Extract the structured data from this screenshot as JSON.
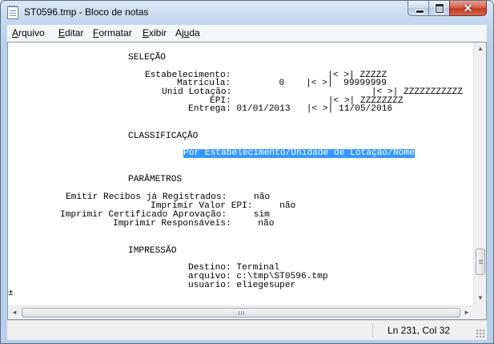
{
  "window": {
    "title": "ST0596.tmp - Bloco de notas",
    "app_icon": "notepad-icon",
    "close_glyph": "✕"
  },
  "menu": [
    {
      "key": "A",
      "rest": "rquivo"
    },
    {
      "key": "E",
      "rest": "ditar"
    },
    {
      "key": "F",
      "rest": "ormatar"
    },
    {
      "key": "E",
      "rest": "xibir"
    },
    {
      "pre": "Aj",
      "key": "u",
      "rest": "da"
    }
  ],
  "document": {
    "selecao_header": "SELEÇÃO",
    "estabelecimento": "Estabelecimento:                  |< >| ZZZZZ",
    "matricula": "Matricula:         0    |< >|  99999999",
    "unid_lotacao": "Unid Lotação:                          |< >| ZZZZZZZZZZZ",
    "epi": "EPI:                  |< >| ZZZZZZZZ",
    "entrega": "Entrega: 01/01/2013   |< >| 11/05/2016",
    "classificacao_header": "CLASSIFICAÇÃO",
    "classificacao_value": "Por Estabelecimento/Unidade de Lotação/Nome",
    "parametros_header": "PARÂMETROS",
    "emitir_recibos": "Emitir Recibos já Registrados:     não",
    "imprimir_valor_epi": "Imprimir Valor EPI:     não",
    "imprimir_certificado": "Imprimir Certificado Aprovação:     sim",
    "imprimir_responsaveis": "Imprimir Responsáveis:     não",
    "impressao_header": "IMPRESSÃO",
    "destino": "Destino: Terminal",
    "arquivo": "arquivo: c:\\tmp\\ST0596.tmp",
    "usuario": "usuario: eliegesuper",
    "trailing_char": "±"
  },
  "scroll": {
    "up": "▲",
    "down": "▼",
    "left": "◄",
    "right": "►",
    "vertical_position": 0.92
  },
  "status": {
    "position": "Ln 231, Col 32"
  }
}
